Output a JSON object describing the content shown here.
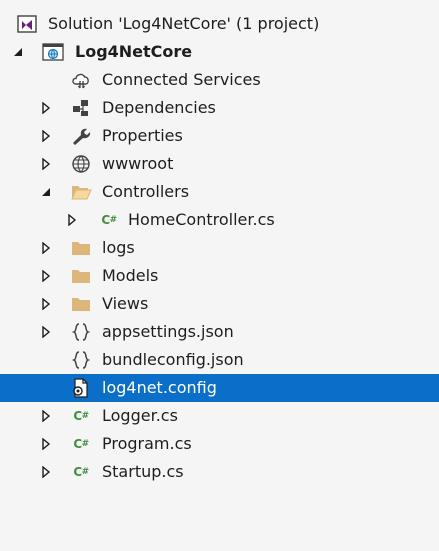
{
  "solution_explorer": {
    "solution": {
      "label": "Solution 'Log4NetCore' (1 project)",
      "icon": "visual-studio-solution-icon"
    },
    "project": {
      "label": "Log4NetCore",
      "icon": "web-project-icon",
      "expanded": true
    },
    "items": [
      {
        "label": "Connected Services",
        "icon": "cloud-services-icon"
      },
      {
        "label": "Dependencies",
        "icon": "dependencies-icon",
        "expander": "collapsed"
      },
      {
        "label": "Properties",
        "icon": "wrench-icon",
        "expander": "collapsed"
      },
      {
        "label": "wwwroot",
        "icon": "globe-icon",
        "expander": "collapsed"
      },
      {
        "label": "Controllers",
        "icon": "folder-open-icon",
        "expander": "expanded"
      },
      {
        "label": "HomeController.cs",
        "icon": "csharp-file-icon",
        "expander": "collapsed"
      },
      {
        "label": "logs",
        "icon": "folder-icon",
        "expander": "collapsed"
      },
      {
        "label": "Models",
        "icon": "folder-icon",
        "expander": "collapsed"
      },
      {
        "label": "Views",
        "icon": "folder-icon",
        "expander": "collapsed"
      },
      {
        "label": "appsettings.json",
        "icon": "json-file-icon",
        "expander": "collapsed"
      },
      {
        "label": "bundleconfig.json",
        "icon": "json-file-icon"
      },
      {
        "label": "log4net.config",
        "icon": "config-file-icon",
        "selected": true
      },
      {
        "label": "Logger.cs",
        "icon": "csharp-file-icon",
        "expander": "collapsed"
      },
      {
        "label": "Program.cs",
        "icon": "csharp-file-icon",
        "expander": "collapsed"
      },
      {
        "label": "Startup.cs",
        "icon": "csharp-file-icon",
        "expander": "collapsed"
      }
    ]
  },
  "colors": {
    "background": "#f5f5f5",
    "selection": "#0b6fc9",
    "folder": "#dcb67a",
    "csharp": "#3e8f3e",
    "solution_purple": "#68217a"
  }
}
